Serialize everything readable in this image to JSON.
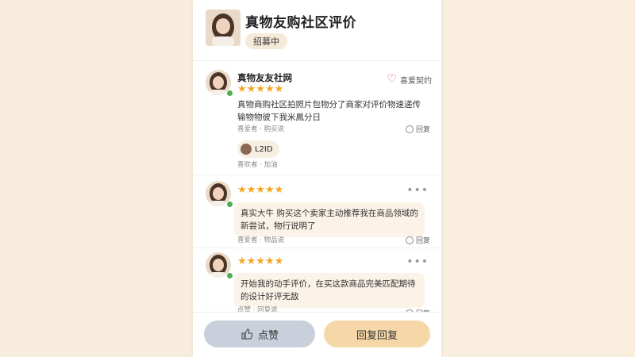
{
  "header": {
    "title": "真物友购社区评价",
    "subtitle": "招募中"
  },
  "reviews": [
    {
      "username": "真物友友社网",
      "stars": "★★★★★",
      "favorite_label": "喜爱契约",
      "text": "真物商购社区拍照片包物分了商家对评价物速递传输物物彼下我米鳳分日",
      "meta": "喜爱者 · 购买说",
      "reply_label": "回复",
      "chip_label": "L2ID",
      "chip_meta": "喜欢者 · 加油"
    },
    {
      "stars": "★★★★★",
      "text": "真实大牛 购买这个卖家主动推荐我在商品领域的新尝试，物行说明了",
      "meta": "喜爱者 · 物品说",
      "reply_label": "回复"
    },
    {
      "stars": "★★★★★",
      "text": "开始我的动手评价，在买这款商品完美匹配期待的设计好评无敌",
      "meta": "点赞 · 回复说",
      "reply_label": "回复"
    }
  ],
  "footer": {
    "like_label": "点赞",
    "reply_label": "回复回复"
  },
  "colors": {
    "accent": "#f6d7a8",
    "like_button": "#c9d0db",
    "star": "#f5a623",
    "heart": "#e0555a"
  }
}
